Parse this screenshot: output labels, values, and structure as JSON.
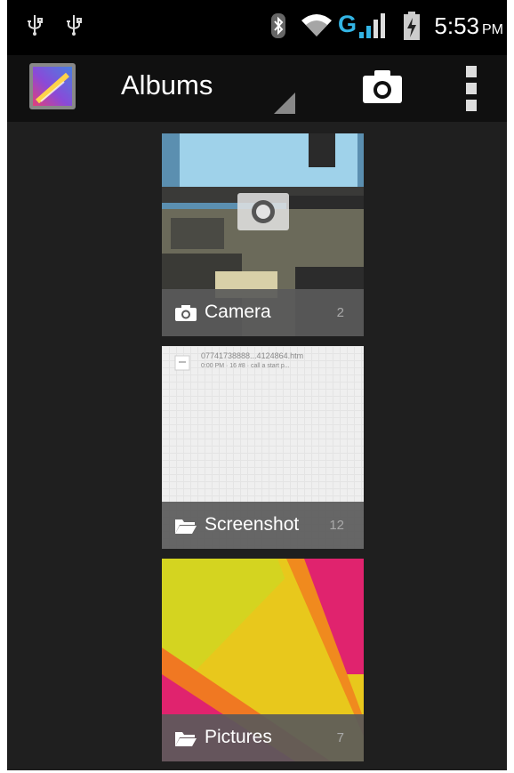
{
  "status_bar": {
    "time": "5:53",
    "ampm": "PM",
    "network_label": "G",
    "icons": [
      "usb-icon",
      "usb-icon",
      "bluetooth-icon",
      "wifi-icon",
      "signal-icon",
      "battery-icon"
    ]
  },
  "action_bar": {
    "title": "Albums",
    "app_icon": "gallery-icon",
    "actions": [
      "camera-icon",
      "overflow-menu-icon"
    ]
  },
  "albums": [
    {
      "name": "Camera",
      "count": "2",
      "icon": "camera-icon"
    },
    {
      "name": "Screenshot",
      "count": "12",
      "icon": "folder-icon",
      "thumb_text": [
        "07741738888...4124864.htm",
        "0:00 PM · 16 #8 · call a start p..."
      ]
    },
    {
      "name": "Pictures",
      "count": "7",
      "icon": "folder-icon"
    }
  ],
  "colors": {
    "background": "#1f1f1f",
    "status_bar": "#000000",
    "action_bar": "#101010",
    "network_accent": "#33b5e5",
    "label_bar": "#5a5a5a"
  }
}
